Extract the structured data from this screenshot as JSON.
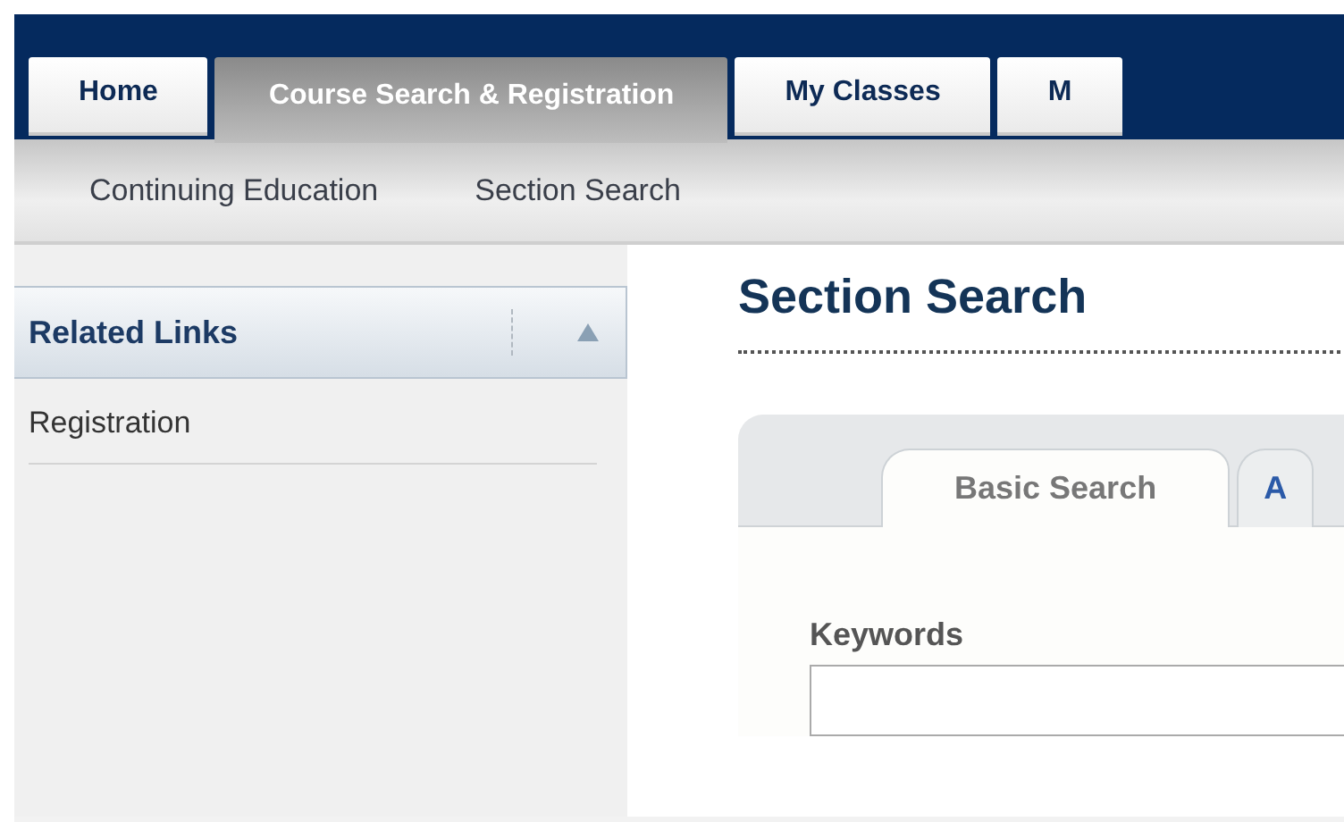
{
  "tabs": [
    {
      "label": "Home",
      "selected": false
    },
    {
      "label": "Course Search & Registration",
      "selected": true
    },
    {
      "label": "My Classes",
      "selected": false
    },
    {
      "label": "M",
      "selected": false
    }
  ],
  "subnav": [
    "Continuing Education",
    "Section Search"
  ],
  "sidebar": {
    "title": "Related Links",
    "expanded": true,
    "items": [
      "Registration"
    ]
  },
  "page_title": "Section Search",
  "search_tabs": [
    {
      "label": "Basic Search",
      "selected": true
    },
    {
      "label": "A",
      "selected": false
    }
  ],
  "fields": [
    {
      "label": "Keywords"
    }
  ]
}
